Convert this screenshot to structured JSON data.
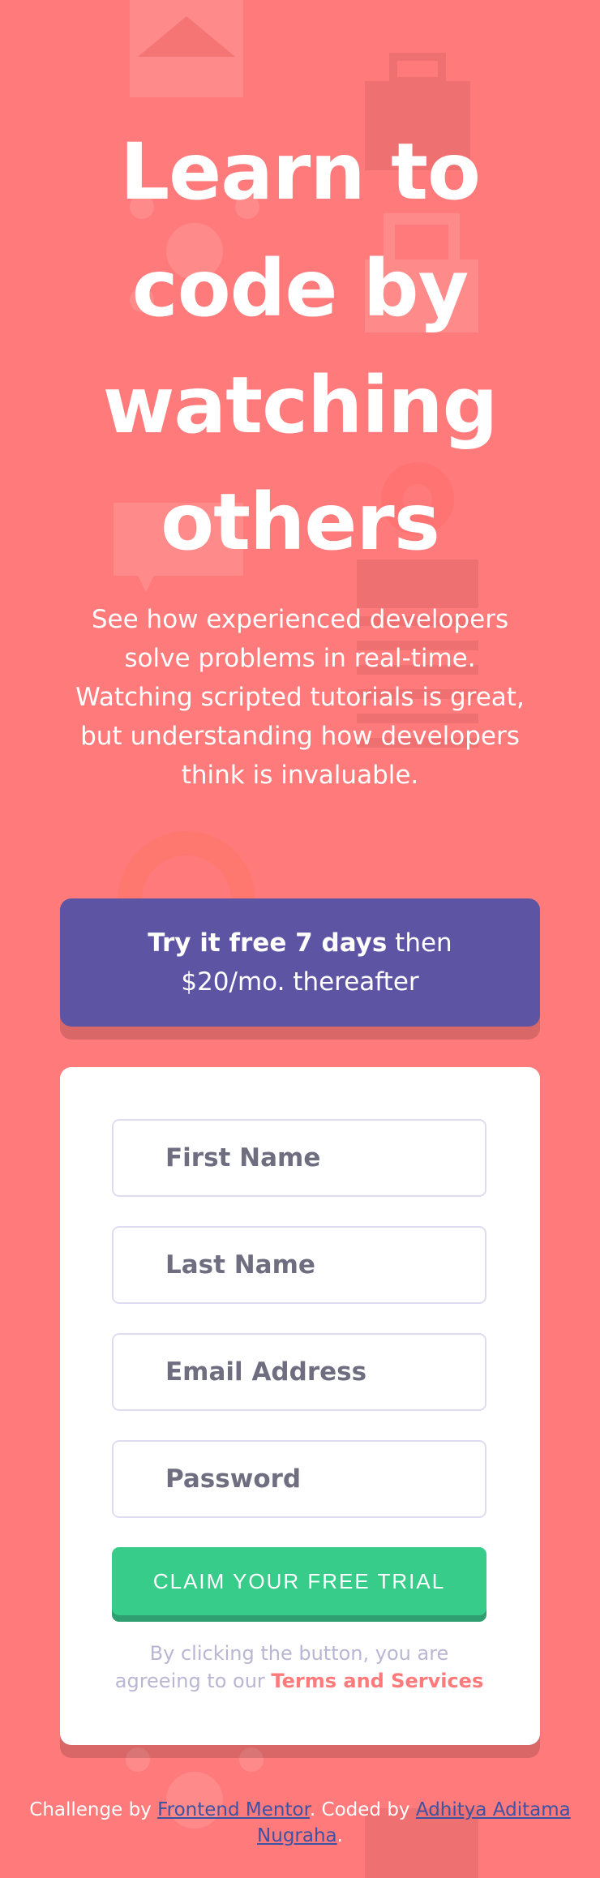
{
  "page": {
    "headline": "Learn to code by watching others",
    "intro": "See how experienced developers solve problems in real-time. Watching scripted tutorials is great, but understanding how developers think is invaluable."
  },
  "promo": {
    "strong": "Try it free 7 days",
    "rest": " then $20/mo. thereafter"
  },
  "form": {
    "first_name_placeholder": "First Name",
    "last_name_placeholder": "Last Name",
    "email_placeholder": "Email Address",
    "password_placeholder": "Password",
    "submit_label": "CLAIM YOUR FREE TRIAL",
    "terms_prefix": "By clicking the button, you are agreeing to our ",
    "terms_link": "Terms and Services"
  },
  "footer": {
    "prefix": "Challenge by ",
    "link1": "Frontend Mentor",
    "middle": ". Coded by ",
    "link2": "Adhitya Aditama Nugraha",
    "suffix": "."
  },
  "colors": {
    "background": "#ff7a7a",
    "promo": "#5e54a4",
    "submit": "#38cc8b",
    "accent": "#ff7a7a"
  }
}
